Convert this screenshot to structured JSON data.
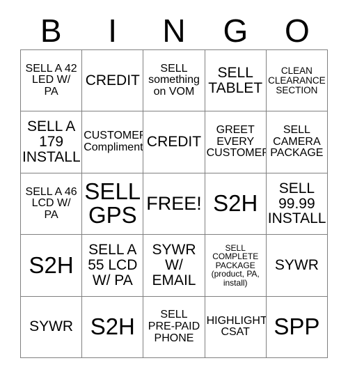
{
  "card": {
    "headers": [
      "B",
      "I",
      "N",
      "G",
      "O"
    ],
    "free_space_index": 12,
    "border_color": "#808080",
    "background_color": "#ffffff",
    "text_color": "#000000",
    "cells": [
      {
        "text": "SELL A 42\nLED W/\nPA",
        "size": "fs-sm"
      },
      {
        "text": "CREDIT",
        "size": "fs-md"
      },
      {
        "text": "SELL\nsomething\non VOM",
        "size": "fs-sm"
      },
      {
        "text": "SELL\nTABLET",
        "size": "fs-md"
      },
      {
        "text": "CLEAN\nCLEARANCE\nSECTION",
        "size": "fs-xs"
      },
      {
        "text": "SELL A\n179\nINSTALL",
        "size": "fs-md"
      },
      {
        "text": "CUSTOMER\nCompliment",
        "size": "fs-sm"
      },
      {
        "text": "CREDIT",
        "size": "fs-md"
      },
      {
        "text": "GREET\nEVERY\nCUSTOMER",
        "size": "fs-sm"
      },
      {
        "text": "SELL\nCAMERA\nPACKAGE",
        "size": "fs-sm"
      },
      {
        "text": "SELL A 46\nLCD W/\nPA",
        "size": "fs-sm"
      },
      {
        "text": "SELL\nGPS",
        "size": "fs-xl"
      },
      {
        "text": "FREE!",
        "size": "fs-lg"
      },
      {
        "text": "S2H",
        "size": "fs-xl"
      },
      {
        "text": "SELL\n99.99\nINSTALL",
        "size": "fs-md"
      },
      {
        "text": "S2H",
        "size": "fs-xl"
      },
      {
        "text": "SELL A\n55 LCD\nW/ PA",
        "size": "fs-md"
      },
      {
        "text": "SYWR\nW/\nEMAIL",
        "size": "fs-md"
      },
      {
        "text": "SELL\nCOMPLETE\nPACKAGE\n(product, PA,\ninstall)",
        "size": "fs-xxs"
      },
      {
        "text": "SYWR",
        "size": "fs-md"
      },
      {
        "text": "SYWR",
        "size": "fs-md"
      },
      {
        "text": "S2H",
        "size": "fs-xl"
      },
      {
        "text": "SELL\nPRE-PAID\nPHONE",
        "size": "fs-sm"
      },
      {
        "text": "HIGHLIGHT\nCSAT",
        "size": "fs-sm"
      },
      {
        "text": "SPP",
        "size": "fs-xl"
      }
    ]
  }
}
